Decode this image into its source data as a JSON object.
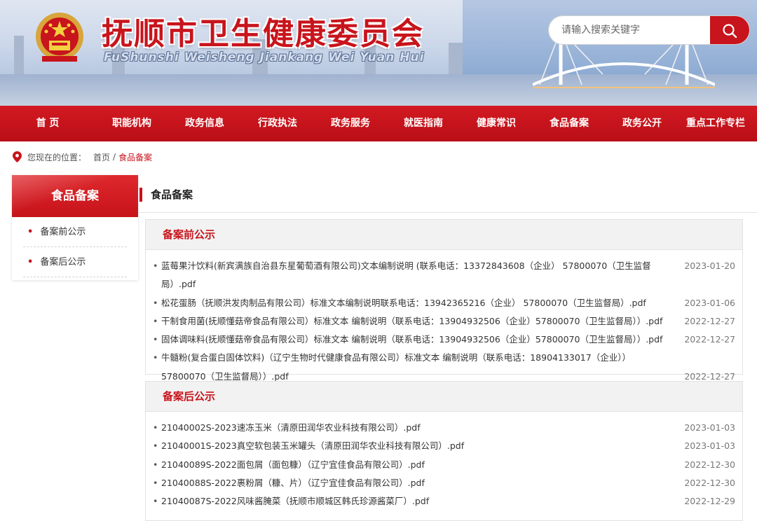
{
  "site": {
    "title": "抚顺市卫生健康委员会",
    "subtitle": "FuShunshi Weisheng Jiankang Wei Yuan Hui"
  },
  "search": {
    "placeholder": "请输入搜索关键字"
  },
  "nav": [
    "首 页",
    "职能机构",
    "政务信息",
    "行政执法",
    "政务服务",
    "就医指南",
    "健康常识",
    "食品备案",
    "政务公开",
    "重点工作专栏"
  ],
  "breadcrumb": {
    "label": "您现在的位置：",
    "home": "首页",
    "sep": "/",
    "current": "食品备案"
  },
  "sidebar": {
    "title": "食品备案",
    "items": [
      "备案前公示",
      "备案后公示"
    ]
  },
  "main": {
    "title": "食品备案",
    "sections": [
      {
        "title": "备案前公示",
        "rows": [
          {
            "text": "蓝莓果汁饮料(新宾满族自治县东星葡萄酒有限公司)文本编制说明 (联系电话：13372843608（企业） 57800070（卫生监督局）.pdf",
            "date": "2023-01-20"
          },
          {
            "text": "松花蛋肠（抚顺洪发肉制品有限公司）标准文本编制说明联系电话：13942365216（企业） 57800070（卫生监督局）.pdf",
            "date": "2023-01-06"
          },
          {
            "text": "干制食用菌(抚顺懂菇帝食品有限公司）标准文本 编制说明（联系电话：13904932506（企业）57800070（卫生监督局））.pdf",
            "date": "2022-12-27"
          },
          {
            "text": "固体调味料(抚顺懂菇帝食品有限公司）标准文本 编制说明（联系电话：13904932506（企业）57800070（卫生监督局））.pdf",
            "date": "2022-12-27"
          },
          {
            "text": "牛髓粉(复合蛋白固体饮料)（辽宁生物时代健康食品有限公司）标准文本 编制说明（联系电话：18904133017（企业））57800070（卫生监督局））.pdf",
            "date": "2022-12-27"
          }
        ]
      },
      {
        "title": "备案后公示",
        "rows": [
          {
            "text": "21040002S-2023速冻玉米（清原田润华农业科技有限公司）.pdf",
            "date": "2023-01-03"
          },
          {
            "text": "21040001S-2023真空软包装玉米罐头（清原田润华农业科技有限公司）.pdf",
            "date": "2023-01-03"
          },
          {
            "text": "21040089S-2022面包屑（面包糠）（辽宁宜佳食品有限公司）.pdf",
            "date": "2022-12-30"
          },
          {
            "text": "21040088S-2022裹粉屑（糠、片）（辽宁宜佳食品有限公司）.pdf",
            "date": "2022-12-30"
          },
          {
            "text": "21040087S-2022风味酱腌菜（抚顺市顺城区韩氏珍源酱菜厂）.pdf",
            "date": "2022-12-29"
          }
        ]
      }
    ]
  },
  "colors": {
    "brand_red": "#c8141c",
    "panel_bg": "#f2f2f2"
  }
}
